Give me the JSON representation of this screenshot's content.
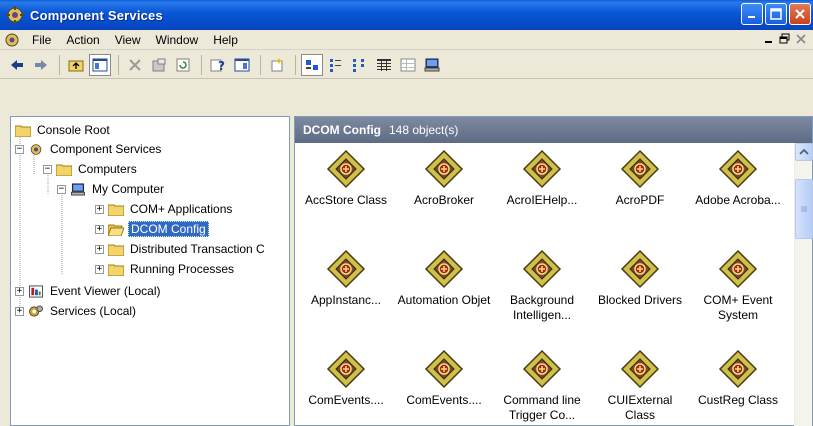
{
  "window": {
    "title": "Component Services"
  },
  "menu": [
    "File",
    "Action",
    "View",
    "Window",
    "Help"
  ],
  "toolbar": {
    "icons": [
      "back-arrow-icon",
      "forward-arrow-icon",
      "up-folder-icon",
      "show-hide-tree-icon",
      "delete-icon",
      "properties-icon",
      "refresh-icon",
      "help-icon",
      "console-tree-icon",
      "new-window-icon",
      "large-icons-icon",
      "small-icons-icon",
      "list-view-icon",
      "detail-view-icon",
      "status-view-icon",
      "computer-icon"
    ]
  },
  "tree": {
    "nodes": [
      {
        "label": "Console Root",
        "depth": 0,
        "expander": "",
        "icon": "folder",
        "selected": false
      },
      {
        "label": "Component Services",
        "depth": 1,
        "expander": "−",
        "icon": "com-services",
        "selected": false
      },
      {
        "label": "Computers",
        "depth": 2,
        "expander": "−",
        "icon": "folder",
        "selected": false
      },
      {
        "label": "My Computer",
        "depth": 3,
        "expander": "−",
        "icon": "computer",
        "selected": false
      },
      {
        "label": "COM+ Applications",
        "depth": 4,
        "expander": "+",
        "icon": "folder",
        "selected": false
      },
      {
        "label": "DCOM Config",
        "depth": 4,
        "expander": "+",
        "icon": "folder-open",
        "selected": true
      },
      {
        "label": "Distributed Transaction C",
        "depth": 4,
        "expander": "+",
        "icon": "folder",
        "selected": false
      },
      {
        "label": "Running Processes",
        "depth": 4,
        "expander": "+",
        "icon": "folder",
        "selected": false
      },
      {
        "label": "Event Viewer (Local)",
        "depth": 1,
        "expander": "+",
        "icon": "event-viewer",
        "selected": false
      },
      {
        "label": "Services (Local)",
        "depth": 1,
        "expander": "+",
        "icon": "services",
        "selected": false
      }
    ]
  },
  "list": {
    "title": "DCOM Config",
    "count": "148 object(s)",
    "items": [
      "AccStore Class",
      "AcroBroker",
      "AcroIEHelp...",
      "AcroPDF",
      "Adobe Acroba...",
      "AppInstanc...",
      "Automation Objet",
      "Background Intelligen...",
      "Blocked Drivers",
      "COM+ Event System",
      "ComEvents....",
      "ComEvents....",
      "Command line Trigger Co...",
      "CUIExternal Class",
      "CustReg Class"
    ]
  },
  "colors": {
    "selection": "#316ac5",
    "titlebar": "#0548c8",
    "header": "#6b7891"
  }
}
